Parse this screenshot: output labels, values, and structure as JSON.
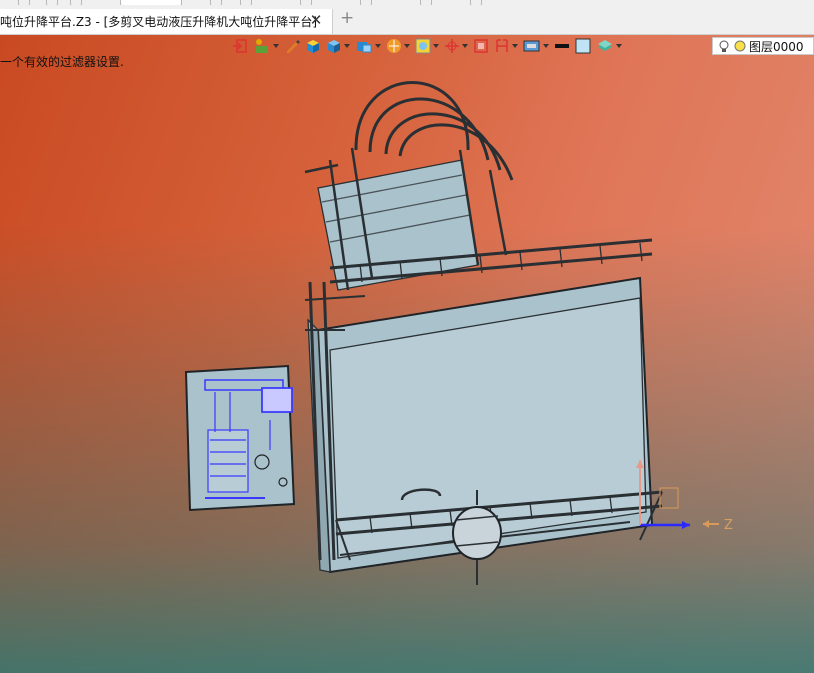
{
  "window": {
    "tab_title": "吨位升降平台.Z3 - [多剪叉电动液压升降机大吨位升降平台]",
    "close_glyph": "✕",
    "add_tab_glyph": "+"
  },
  "viewport": {
    "filter_message": "一个有效的过滤器设置.",
    "axis_label": "Z"
  },
  "toolbar": {
    "icons": [
      "exit-icon",
      "assembly-icon",
      "pen-icon",
      "box-icon",
      "cube-icon",
      "solid-icon",
      "render-icon",
      "view-icon",
      "axis-icon",
      "frame-icon",
      "bracket-icon",
      "display-icon",
      "line-style-icon",
      "color-icon",
      "layer-icon"
    ],
    "layer": {
      "name": "图层0000"
    }
  },
  "colors": {
    "bg_top": "#c94a22",
    "bg_bottom": "#2d7873",
    "model": "#a9c2cc",
    "edge": "#2a2f33",
    "highlight": "#3a3aff"
  }
}
